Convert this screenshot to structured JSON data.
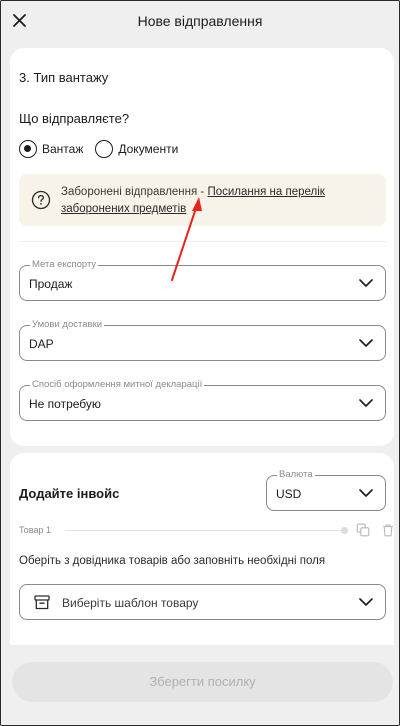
{
  "header": {
    "title": "Нове відправлення",
    "close_icon": "close-icon"
  },
  "section": {
    "title": "3. Тип вантажу",
    "question": "Що відправляєте?",
    "options": [
      {
        "label": "Вантаж",
        "selected": true
      },
      {
        "label": "Документи",
        "selected": false
      }
    ]
  },
  "notice": {
    "icon": "question-circle-icon",
    "prefix": "Заборонені відправлення - ",
    "link": "Посилання на перелік заборонених предметів",
    "background": "#f8f3e8"
  },
  "fields": {
    "export_purpose": {
      "label": "Мета експорту",
      "value": "Продаж"
    },
    "delivery_terms": {
      "label": "Умови доставки",
      "value": "DAP"
    },
    "customs_method": {
      "label": "Спосіб оформлення митної декларації",
      "value": "Не потребую"
    }
  },
  "invoice": {
    "title": "Додайте інвойс",
    "currency_label": "Валюта",
    "currency_value": "USD",
    "item_label": "Товар 1",
    "hint": "Оберіть з довідника товарів або заповніть необхідні поля",
    "template_placeholder": "Виберіть шаблон товару"
  },
  "footer": {
    "save_label": "Зберегти посилку"
  },
  "colors": {
    "annotation_arrow": "#e8231f",
    "text": "#1c1c1c",
    "muted": "#8a8a8a"
  }
}
